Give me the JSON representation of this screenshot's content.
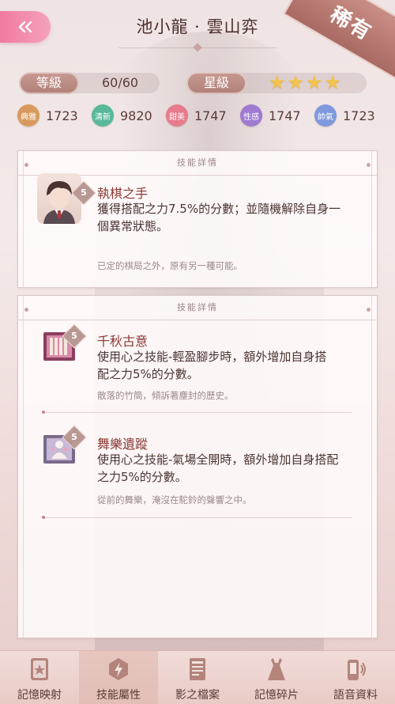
{
  "header": {
    "title": "池小龍 · 雲山弈",
    "rarity": "稀有"
  },
  "stats": {
    "level_label": "等級",
    "level_value": "60/60",
    "star_label": "星級",
    "stars": 4
  },
  "attributes": [
    {
      "icon_text": "典雅",
      "value": "1723",
      "color": "#d89a5c"
    },
    {
      "icon_text": "清新",
      "value": "9820",
      "color": "#58b99a"
    },
    {
      "icon_text": "甜美",
      "value": "1747",
      "color": "#e77b8c"
    },
    {
      "icon_text": "性感",
      "value": "1747",
      "color": "#a07ad0"
    },
    {
      "icon_text": "帥氣",
      "value": "1723",
      "color": "#7f98dd"
    }
  ],
  "panel1": {
    "header": "技能詳情",
    "skill": {
      "level": "5",
      "name": "執棋之手",
      "desc_line1": "獲得搭配之力7.5%的分數；並隨機解除自身一",
      "desc_line2": "個異常狀態。",
      "flavor": "已定的棋局之外，原有另一種可能。"
    }
  },
  "panel2": {
    "header": "技能詳情",
    "skills": [
      {
        "level": "5",
        "name": "千秋古意",
        "desc_line1": "使用心之技能-輕盈腳步時，額外增加自身搭",
        "desc_line2": "配之力5%的分數。",
        "flavor": "散落的竹簡，傾訴著塵封的歷史。"
      },
      {
        "level": "5",
        "name": "舞樂遺蹤",
        "desc_line1": "使用心之技能-氣場全開時，額外增加自身搭配",
        "desc_line2": "之力5%的分數。",
        "flavor": "從前的舞樂，淹沒在駝鈴的聲響之中。"
      }
    ]
  },
  "nav": [
    {
      "label": "記憶映射",
      "icon": "memory-card-icon"
    },
    {
      "label": "技能屬性",
      "icon": "skill-icon",
      "active": true
    },
    {
      "label": "影之檔案",
      "icon": "file-icon"
    },
    {
      "label": "記憶碎片",
      "icon": "dress-icon"
    },
    {
      "label": "語音資料",
      "icon": "voice-icon"
    }
  ]
}
